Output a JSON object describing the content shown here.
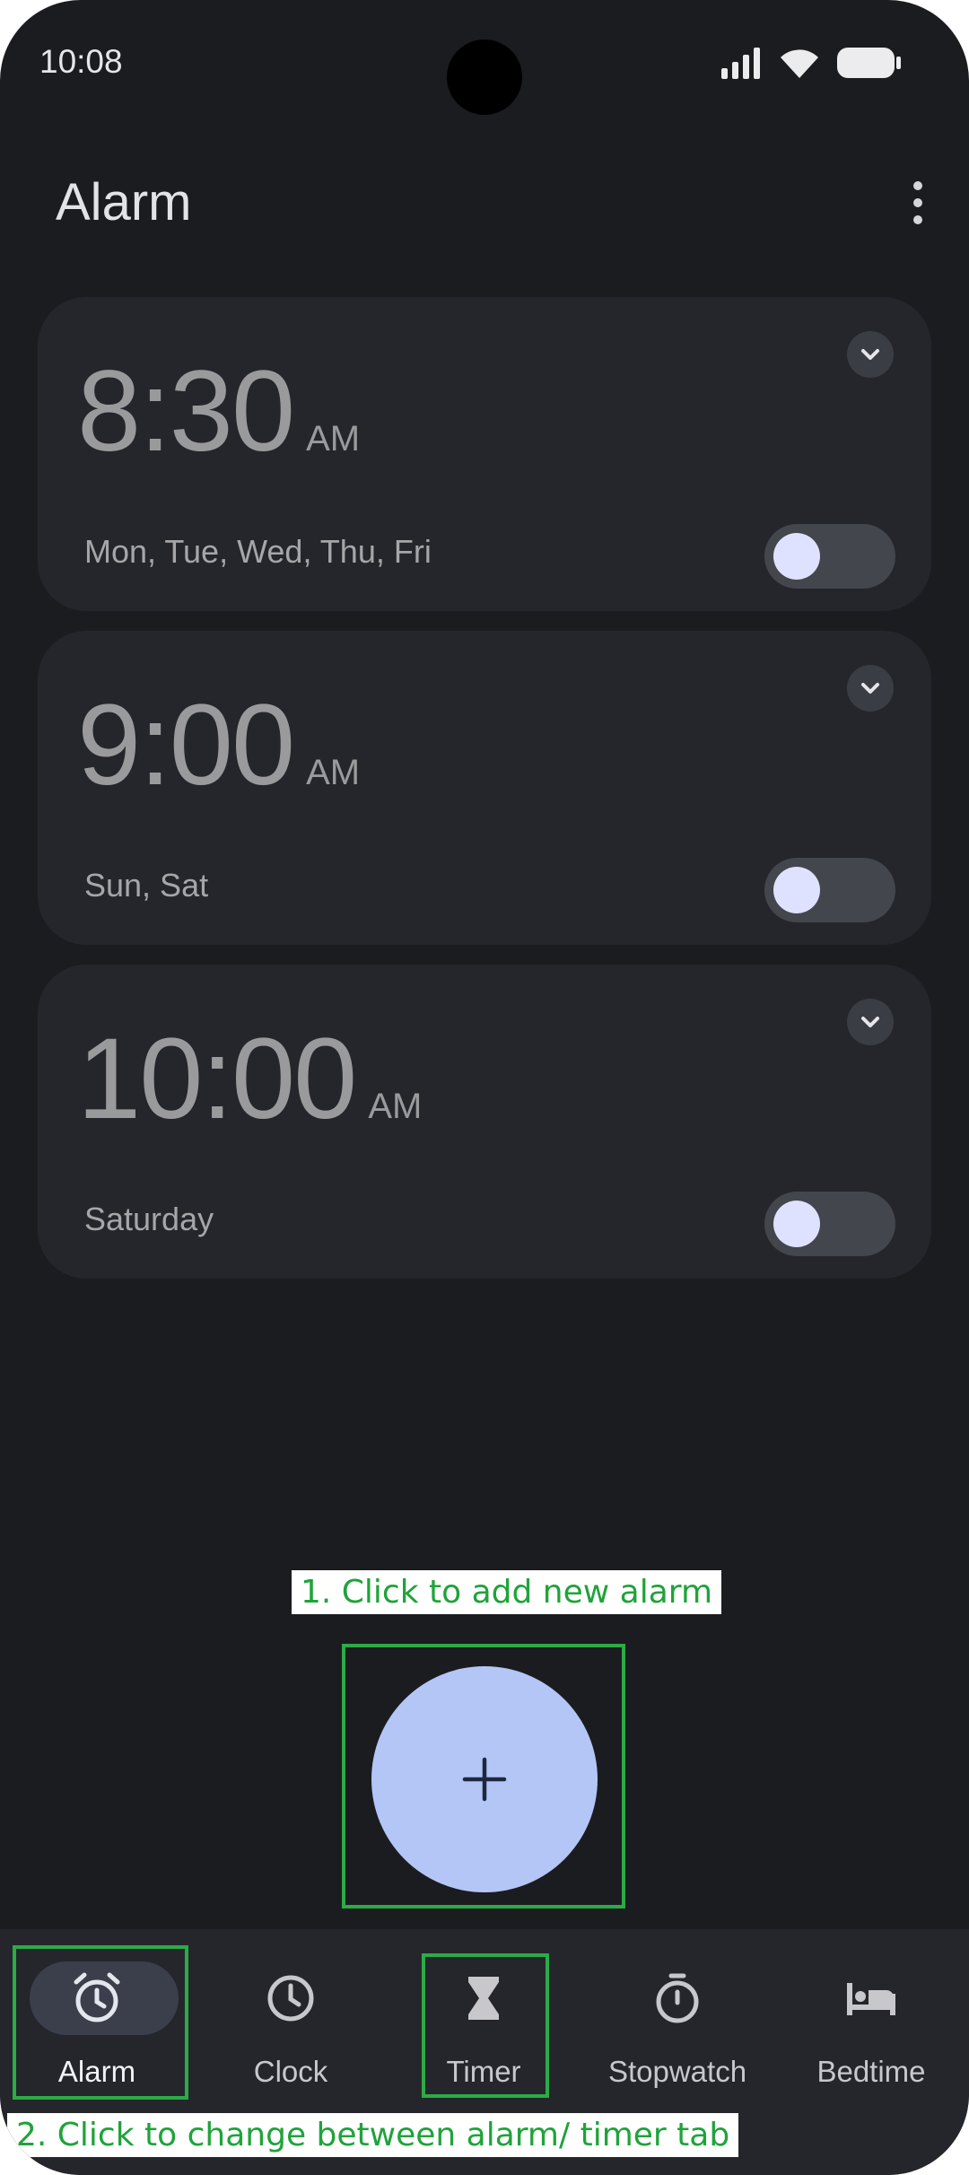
{
  "status_bar": {
    "time": "10:08",
    "icons": [
      "signal-icon",
      "wifi-icon",
      "battery-icon"
    ]
  },
  "header": {
    "title": "Alarm",
    "menu_icon": "more-vert-icon"
  },
  "alarms": [
    {
      "time": "8:30",
      "ampm": "AM",
      "days": "Mon, Tue, Wed, Thu, Fri",
      "enabled": false
    },
    {
      "time": "9:00",
      "ampm": "AM",
      "days": "Sun, Sat",
      "enabled": false
    },
    {
      "time": "10:00",
      "ampm": "AM",
      "days": "Saturday",
      "enabled": false
    }
  ],
  "fab": {
    "symbol": "+",
    "icon": "add-icon"
  },
  "annotations": {
    "add_alarm": "1. Click to add new alarm",
    "change_tab": "2. Click to change between alarm/ timer tab"
  },
  "bottom_nav": [
    {
      "label": "Alarm",
      "icon": "alarm-clock-icon",
      "active": true
    },
    {
      "label": "Clock",
      "icon": "clock-icon",
      "active": false
    },
    {
      "label": "Timer",
      "icon": "hourglass-icon",
      "active": false
    },
    {
      "label": "Stopwatch",
      "icon": "stopwatch-icon",
      "active": false
    },
    {
      "label": "Bedtime",
      "icon": "bed-icon",
      "active": false
    }
  ],
  "colors": {
    "background": "#1b1c20",
    "card": "#24262b",
    "fab": "#b3c6f6",
    "toggle_knob": "#dfe2ff",
    "annotation": "#1fa33a"
  }
}
